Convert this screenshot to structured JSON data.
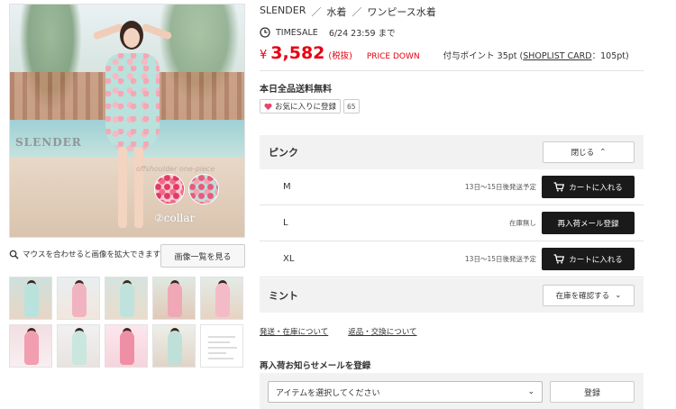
{
  "breadcrumb": {
    "brand": "SLENDER",
    "sep": "／",
    "cat1": "水着",
    "cat2": "ワンピース水着"
  },
  "timesale": {
    "label": "TIMESALE",
    "until": "6/24 23:59 まで"
  },
  "price": {
    "yen": "¥",
    "amount": "3,582",
    "tax": "(税抜)",
    "badge": "PRICE DOWN",
    "points_prefix": "付与ポイント  35pt (",
    "points_link": "SHOPLIST CARD",
    "points_suffix": "：105pt)"
  },
  "free_shipping": "本日全品送料無料",
  "favorite": {
    "label": "お気に入りに登録",
    "count": "65"
  },
  "gallery": {
    "main_overlay_logo": "SLENDER",
    "main_overlay_caption": "offshoulder one-piece",
    "main_overlay_collar": "②collar",
    "zoom_hint": "マウスを合わせると画像を拡大できます",
    "list_button": "画像一覧を見る"
  },
  "colors": [
    {
      "name": "ピンク",
      "toggle": "閉じる",
      "sizes": [
        {
          "size": "M",
          "ship": "13日〜15日後発送予定",
          "action": "カートに入れる",
          "type": "cart"
        },
        {
          "size": "L",
          "ship": "在庫無し",
          "action": "再入荷メール登録",
          "type": "restock"
        },
        {
          "size": "XL",
          "ship": "13日〜15日後発送予定",
          "action": "カートに入れる",
          "type": "cart"
        }
      ]
    },
    {
      "name": "ミント",
      "toggle": "在庫を確認する"
    }
  ],
  "links": {
    "shipping": "発送・在庫について",
    "returns": "返品・交換について"
  },
  "notify": {
    "title": "再入荷お知らせメールを登録",
    "select_placeholder": "アイテムを選択してください",
    "button": "登録"
  },
  "colors_theme": {
    "accent_red": "#e60012",
    "dark_button": "#1a1a1a",
    "panel_bg": "#f2f2f2"
  }
}
